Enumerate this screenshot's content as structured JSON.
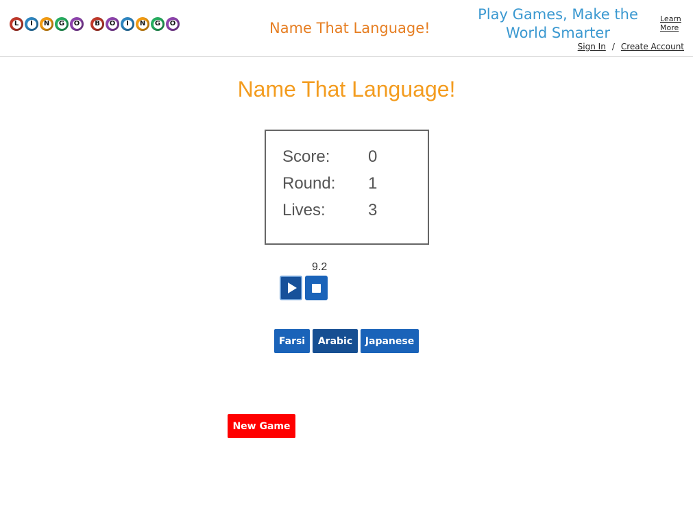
{
  "header": {
    "logo": {
      "word1": [
        {
          "letter": "L",
          "color": "#c0392b"
        },
        {
          "letter": "I",
          "color": "#2e86c1"
        },
        {
          "letter": "N",
          "color": "#f39c12"
        },
        {
          "letter": "G",
          "color": "#27ae60"
        },
        {
          "letter": "O",
          "color": "#8e44ad"
        }
      ],
      "word2": [
        {
          "letter": "B",
          "color": "#c0392b"
        },
        {
          "letter": "O",
          "color": "#8e44ad"
        },
        {
          "letter": "I",
          "color": "#2e86c1"
        },
        {
          "letter": "N",
          "color": "#f39c12"
        },
        {
          "letter": "G",
          "color": "#27ae60"
        },
        {
          "letter": "O",
          "color": "#8e44ad"
        }
      ]
    },
    "title": "Name That Language!",
    "tagline": "Play Games, Make the World Smarter",
    "learn_more": "Learn More",
    "sign_in": "Sign In",
    "separator": "/",
    "create_account": "Create Account"
  },
  "game": {
    "title": "Name That Language!",
    "stats": {
      "score_label": "Score:",
      "score_value": "0",
      "round_label": "Round:",
      "round_value": "1",
      "lives_label": "Lives:",
      "lives_value": "3"
    },
    "timer": "9.2",
    "controls": {
      "play_icon": "play-icon",
      "stop_icon": "stop-icon"
    },
    "choices": [
      "Farsi",
      "Arabic",
      "Japanese"
    ],
    "new_game_label": "New Game"
  },
  "colors": {
    "title_orange": "#f39c1f",
    "tagline_blue": "#3a98d0",
    "button_blue": "#1a63b9",
    "new_game_red": "#ff0000"
  }
}
